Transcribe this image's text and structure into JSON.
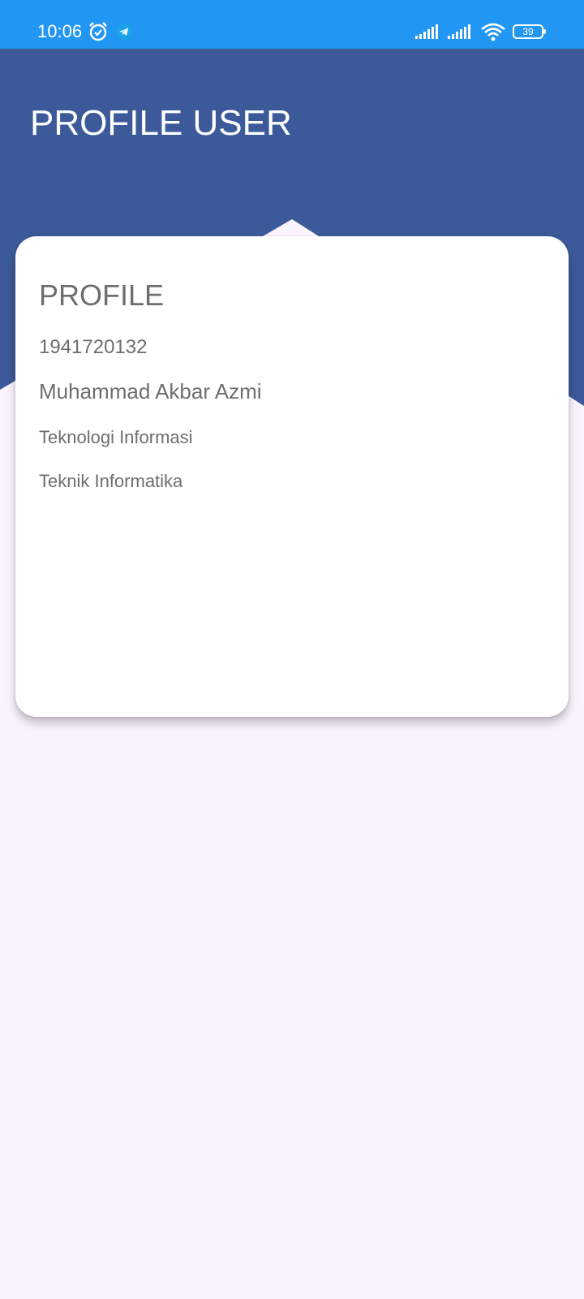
{
  "status_bar": {
    "time": "10:06",
    "battery_level": "39",
    "icons": [
      "alarm-icon",
      "telegram-icon",
      "signal-icon",
      "signal-icon",
      "wifi-icon",
      "battery-icon"
    ]
  },
  "header": {
    "title": "PROFILE USER",
    "background_color": "#3c5a99"
  },
  "profile_card": {
    "heading": "PROFILE",
    "nim": "1941720132",
    "name": "Muhammad Akbar Azmi",
    "jurusan": "Teknologi Informasi",
    "prodi": "Teknik Informatika"
  },
  "colors": {
    "status_bar": "#2196f3",
    "page_background": "#fbf4ff",
    "card_text": "#6e6e6e"
  }
}
